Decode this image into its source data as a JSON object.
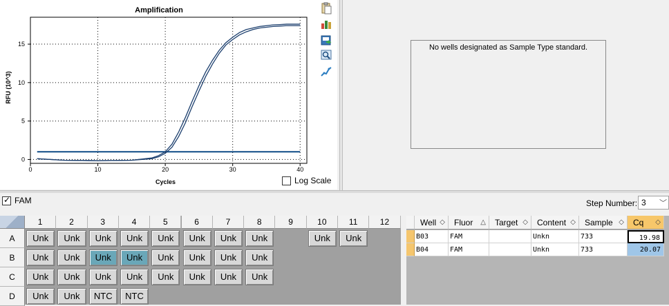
{
  "chart": {
    "title": "Amplification",
    "ylabel": "RFU (10^3)",
    "xlabel": "Cycles",
    "x_ticks": [
      "0",
      "10",
      "20",
      "30",
      "40"
    ],
    "y_ticks": [
      "0",
      "5",
      "10",
      "15"
    ],
    "log_scale_label": "Log Scale",
    "log_scale_checked": false
  },
  "chart_data": {
    "type": "line",
    "title": "Amplification",
    "xlabel": "Cycles",
    "ylabel": "RFU (10^3)",
    "xlim": [
      0,
      41
    ],
    "ylim": [
      -0.5,
      18.5
    ],
    "grid": true,
    "threshold": 1.0,
    "series": [
      {
        "x": [
          1,
          5,
          10,
          15,
          18,
          19,
          20,
          21,
          22,
          23,
          24,
          25,
          26,
          27,
          28,
          29,
          30,
          31,
          32,
          33,
          34,
          35,
          36,
          37,
          38,
          39,
          40
        ],
        "y": [
          0.1,
          -0.1,
          -0.15,
          -0.1,
          0.2,
          0.5,
          1.0,
          2.0,
          3.6,
          5.5,
          7.6,
          9.6,
          11.4,
          12.9,
          14.2,
          15.2,
          15.9,
          16.5,
          16.9,
          17.1,
          17.3,
          17.4,
          17.5,
          17.55,
          17.6,
          17.6,
          17.6
        ]
      },
      {
        "x": [
          1,
          5,
          10,
          15,
          18,
          19,
          20,
          21,
          22,
          23,
          24,
          25,
          26,
          27,
          28,
          29,
          30,
          31,
          32,
          33,
          34,
          35,
          36,
          37,
          38,
          39,
          40
        ],
        "y": [
          0.1,
          -0.1,
          -0.15,
          -0.1,
          0.1,
          0.35,
          0.8,
          1.6,
          3.0,
          4.8,
          6.9,
          8.9,
          10.8,
          12.4,
          13.8,
          14.9,
          15.6,
          16.2,
          16.6,
          16.9,
          17.1,
          17.2,
          17.3,
          17.35,
          17.4,
          17.4,
          17.4
        ]
      }
    ]
  },
  "toolbar_icons": [
    "clipboard-icon",
    "chart-settings-icon",
    "export-icon",
    "zoom-image-icon",
    "trace-icon"
  ],
  "standard_curve": {
    "message": "No wells designated as Sample Type standard."
  },
  "fluor_filter": {
    "label": "FAM",
    "checked": true
  },
  "step": {
    "label": "Step Number:",
    "value": "3"
  },
  "plate": {
    "columns": [
      "1",
      "2",
      "3",
      "4",
      "5",
      "6",
      "7",
      "8",
      "9",
      "10",
      "11",
      "12"
    ],
    "rows": [
      {
        "label": "A",
        "wells": [
          "Unk",
          "Unk",
          "Unk",
          "Unk",
          "Unk",
          "Unk",
          "Unk",
          "Unk",
          "",
          "Unk",
          "Unk",
          ""
        ]
      },
      {
        "label": "B",
        "wells": [
          "Unk",
          "Unk",
          "Unk",
          "Unk",
          "Unk",
          "Unk",
          "Unk",
          "Unk",
          "",
          "",
          "",
          ""
        ]
      },
      {
        "label": "C",
        "wells": [
          "Unk",
          "Unk",
          "Unk",
          "Unk",
          "Unk",
          "Unk",
          "Unk",
          "Unk",
          "",
          "",
          "",
          ""
        ]
      },
      {
        "label": "D",
        "wells": [
          "Unk",
          "Unk",
          "NTC",
          "NTC",
          "",
          "",
          "",
          "",
          "",
          "",
          "",
          ""
        ]
      }
    ]
  },
  "results": {
    "columns": [
      "Well",
      "Fluor",
      "Target",
      "Content",
      "Sample",
      "Cq"
    ],
    "rows": [
      {
        "well": "B03",
        "fluor": "FAM",
        "target": "",
        "content": "Unkn",
        "sample": "733",
        "cq": "19.98"
      },
      {
        "well": "B04",
        "fluor": "FAM",
        "target": "",
        "content": "Unkn",
        "sample": "733",
        "cq": "20.07"
      }
    ]
  },
  "colors": {
    "curve": "#1c3f6e",
    "threshold": "#0e4a86",
    "selected_well": "#6aa7b8",
    "cq_header": "#f7c76a",
    "cq_selected": "#9fc6e8"
  }
}
